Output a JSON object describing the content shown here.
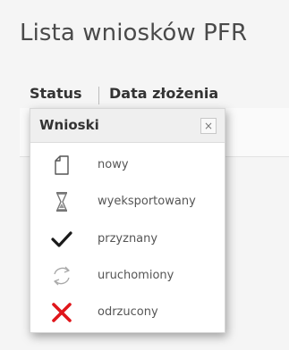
{
  "page": {
    "title": "Lista wniosków PFR"
  },
  "table": {
    "headers": [
      "Status",
      "Data złożenia"
    ]
  },
  "popover": {
    "title": "Wnioski",
    "close_label": "×",
    "items": [
      {
        "label": "nowy",
        "icon": "new-document-icon"
      },
      {
        "label": "wyeksportowany",
        "icon": "hourglass-icon"
      },
      {
        "label": "przyznany",
        "icon": "checkmark-icon"
      },
      {
        "label": "uruchomiony",
        "icon": "refresh-icon"
      },
      {
        "label": "odrzucony",
        "icon": "cross-icon"
      }
    ],
    "colors": {
      "checkmark": "#1a1a1a",
      "cross": "#e0161b",
      "outline": "#555555",
      "muted": "#9a9a9a"
    }
  }
}
